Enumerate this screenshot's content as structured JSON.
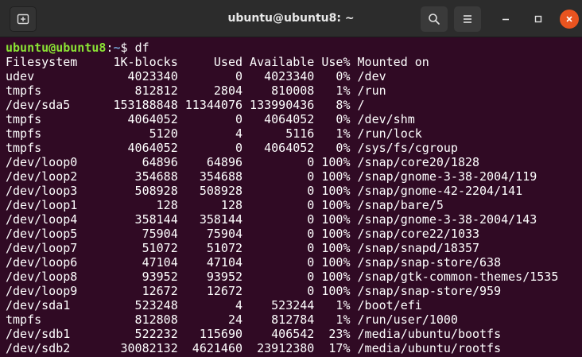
{
  "window": {
    "title": "ubuntu@ubuntu8: ~",
    "icons": {
      "new_tab": "new-tab-icon",
      "search": "search-icon",
      "menu": "hamburger-menu-icon",
      "minimize": "minimize-icon",
      "maximize": "maximize-icon",
      "close": "close-icon"
    },
    "colors": {
      "background": "#300a24",
      "prompt_user": "#8ae234",
      "prompt_path": "#729fcf",
      "close": "#e95420"
    }
  },
  "prompt": {
    "user_host": "ubuntu@ubuntu8",
    "colon": ":",
    "path": "~",
    "symbol": "$ ",
    "command": "df"
  },
  "output": [
    "Filesystem     1K-blocks     Used Available Use% Mounted on",
    "udev             4023340        0   4023340   0% /dev",
    "tmpfs             812812     2804    810008   1% /run",
    "/dev/sda5      153188848 11344076 133990436   8% /",
    "tmpfs            4064052        0   4064052   0% /dev/shm",
    "tmpfs               5120        4      5116   1% /run/lock",
    "tmpfs            4064052        0   4064052   0% /sys/fs/cgroup",
    "/dev/loop0         64896    64896         0 100% /snap/core20/1828",
    "/dev/loop2        354688   354688         0 100% /snap/gnome-3-38-2004/119",
    "/dev/loop3        508928   508928         0 100% /snap/gnome-42-2204/141",
    "/dev/loop1           128      128         0 100% /snap/bare/5",
    "/dev/loop4        358144   358144         0 100% /snap/gnome-3-38-2004/143",
    "/dev/loop5         75904    75904         0 100% /snap/core22/1033",
    "/dev/loop7         51072    51072         0 100% /snap/snapd/18357",
    "/dev/loop6         47104    47104         0 100% /snap/snap-store/638",
    "/dev/loop8         93952    93952         0 100% /snap/gtk-common-themes/1535",
    "/dev/loop9         12672    12672         0 100% /snap/snap-store/959",
    "/dev/sda1         523248        4    523244   1% /boot/efi",
    "tmpfs             812808       24    812784   1% /run/user/1000",
    "/dev/sdb1         522232   115690    406542  23% /media/ubuntu/bootfs",
    "/dev/sdb2       30082132  4621460  23912380  17% /media/ubuntu/rootfs"
  ]
}
